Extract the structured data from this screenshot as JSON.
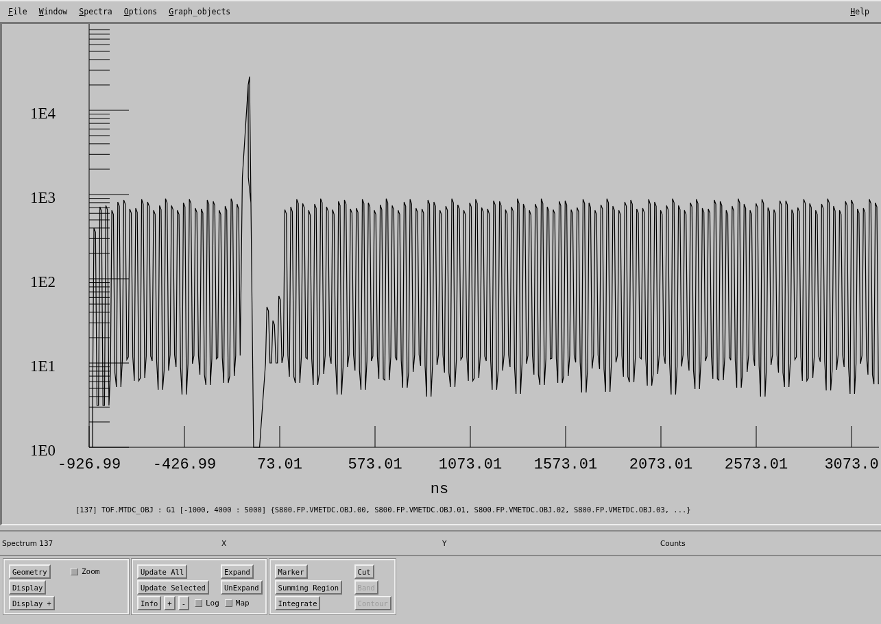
{
  "menu": [
    {
      "label": "File"
    },
    {
      "label": "Window"
    },
    {
      "label": "Spectra"
    },
    {
      "label": "Options"
    },
    {
      "label": "Graph_objects"
    }
  ],
  "help": "Help",
  "plot": {
    "y_ticks": [
      "1E4",
      "1E3",
      "1E2",
      "1E1",
      "1E0"
    ],
    "x_ticks": [
      "-926.99",
      "-426.99",
      "73.01",
      "573.01",
      "1073.01",
      "1573.01",
      "2073.01",
      "2573.01",
      "3073.0"
    ],
    "x_label": "ns",
    "caption": "[137] TOF.MTDC_OBJ : G1 [-1000, 4000 : 5000] {S800.FP.VMETDC.OBJ.00, S800.FP.VMETDC.OBJ.01, S800.FP.VMETDC.OBJ.02, S800.FP.VMETDC.OBJ.03, ...}"
  },
  "status": [
    "Spectrum 137",
    "X",
    "Y",
    "Counts"
  ],
  "groups": [
    {
      "rows": [
        {
          "left": [
            {
              "kind": "button",
              "label": "Geometry",
              "disabled": false
            }
          ],
          "right": [
            {
              "kind": "checkbox",
              "label": "Zoom",
              "checked": false
            }
          ]
        },
        {
          "left": [
            {
              "kind": "button",
              "label": "Display",
              "disabled": false
            }
          ],
          "right": []
        },
        {
          "left": [
            {
              "kind": "button",
              "label": "Display +",
              "disabled": false
            }
          ],
          "right": []
        }
      ]
    },
    {
      "rows": [
        {
          "left": [
            {
              "kind": "button",
              "label": "Update All",
              "disabled": false
            }
          ],
          "right": [
            {
              "kind": "button",
              "label": "Expand",
              "disabled": false
            }
          ]
        },
        {
          "left": [
            {
              "kind": "button",
              "label": "Update Selected",
              "disabled": false
            }
          ],
          "right": [
            {
              "kind": "button",
              "label": "UnExpand",
              "disabled": false
            }
          ]
        },
        {
          "left": [
            {
              "kind": "button",
              "label": "Info",
              "disabled": false
            },
            {
              "kind": "button",
              "label": "+",
              "disabled": false
            },
            {
              "kind": "button",
              "label": "-",
              "disabled": false
            },
            {
              "kind": "checkbox",
              "label": "Log",
              "checked": false
            },
            {
              "kind": "checkbox",
              "label": "Map",
              "checked": false
            }
          ],
          "right": []
        }
      ]
    },
    {
      "rows": [
        {
          "left": [
            {
              "kind": "button",
              "label": "Marker",
              "disabled": false
            }
          ],
          "right": [
            {
              "kind": "button",
              "label": "Cut",
              "disabled": false
            }
          ]
        },
        {
          "left": [
            {
              "kind": "button",
              "label": "Summing Region",
              "disabled": false
            }
          ],
          "right": [
            {
              "kind": "button",
              "label": "Band",
              "disabled": true
            }
          ]
        },
        {
          "left": [
            {
              "kind": "button",
              "label": "Integrate",
              "disabled": false
            }
          ],
          "right": [
            {
              "kind": "button",
              "label": "Contour",
              "disabled": true
            }
          ]
        }
      ]
    }
  ]
}
